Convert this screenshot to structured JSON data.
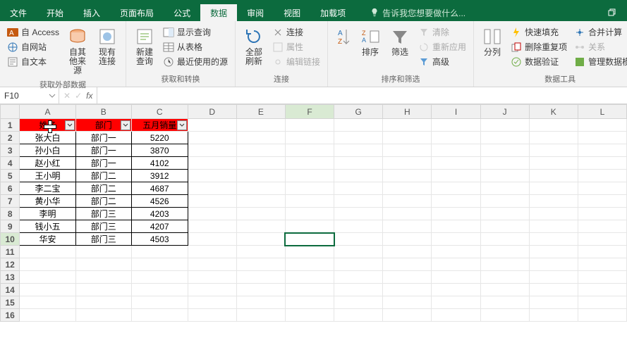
{
  "menu": {
    "tabs": [
      "文件",
      "开始",
      "插入",
      "页面布局",
      "公式",
      "数据",
      "审阅",
      "视图",
      "加载项"
    ],
    "active_index": 5,
    "tellme": "告诉我您想要做什么..."
  },
  "ribbon": {
    "groups": [
      {
        "label": "获取外部数据",
        "items": {
          "access": "自 Access",
          "web": "自网站",
          "text": "自文本",
          "other": "自其他来源",
          "existing": "现有连接"
        }
      },
      {
        "label": "获取和转换",
        "items": {
          "newquery": "新建查询",
          "showquery": "显示查询",
          "fromtable": "从表格",
          "recent": "最近使用的源"
        }
      },
      {
        "label": "连接",
        "items": {
          "refresh": "全部刷新",
          "conn": "连接",
          "prop": "属性",
          "editlink": "编辑链接"
        }
      },
      {
        "label": "排序和筛选",
        "items": {
          "sort": "排序",
          "filter": "筛选",
          "clear": "清除",
          "reapply": "重新应用",
          "advanced": "高级"
        }
      },
      {
        "label": "数据工具",
        "items": {
          "split": "分列",
          "flash": "快速填充",
          "dedupe": "删除重复项",
          "validate": "数据验证",
          "consolidate": "合并计算",
          "relation": "关系",
          "model": "管理数据模型"
        }
      }
    ]
  },
  "namebox": "F10",
  "grid": {
    "cols": [
      "A",
      "B",
      "C",
      "D",
      "E",
      "F",
      "G",
      "H",
      "I",
      "J",
      "K",
      "L"
    ],
    "rowcount": 16,
    "selected": {
      "col": "F",
      "row": 10
    },
    "col_widths": {
      "default": 72,
      "A": 82,
      "B": 82,
      "C": 82
    }
  },
  "table": {
    "headers": [
      "姓名",
      "部门",
      "五月销量"
    ],
    "rows": [
      [
        "张大白",
        "部门一",
        5220
      ],
      [
        "孙小白",
        "部门一",
        3870
      ],
      [
        "赵小红",
        "部门一",
        4102
      ],
      [
        "王小明",
        "部门二",
        3912
      ],
      [
        "李二宝",
        "部门二",
        4687
      ],
      [
        "黄小华",
        "部门二",
        4526
      ],
      [
        "李明",
        "部门三",
        4203
      ],
      [
        "钱小五",
        "部门三",
        4207
      ],
      [
        "华安",
        "部门三",
        4503
      ]
    ]
  },
  "chart_data": {
    "type": "table",
    "title": "五月销量",
    "columns": [
      "姓名",
      "部门",
      "五月销量"
    ],
    "rows": [
      [
        "张大白",
        "部门一",
        5220
      ],
      [
        "孙小白",
        "部门一",
        3870
      ],
      [
        "赵小红",
        "部门一",
        4102
      ],
      [
        "王小明",
        "部门二",
        3912
      ],
      [
        "李二宝",
        "部门二",
        4687
      ],
      [
        "黄小华",
        "部门二",
        4526
      ],
      [
        "李明",
        "部门三",
        4203
      ],
      [
        "钱小五",
        "部门三",
        4207
      ],
      [
        "华安",
        "部门三",
        4503
      ]
    ]
  }
}
